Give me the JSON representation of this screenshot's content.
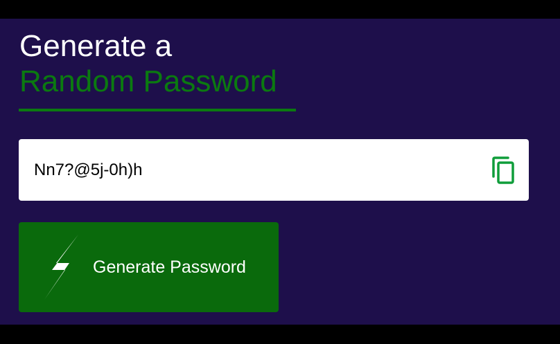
{
  "header": {
    "line1": "Generate a",
    "line2": "Random Password"
  },
  "password": {
    "value": "Nn7?@5j-0h)h",
    "copy_icon": "copy-icon"
  },
  "generate_button": {
    "label": "Generate Password",
    "icon": "lightning-bolt-icon"
  },
  "colors": {
    "background": "#1e0f4b",
    "accent_green": "#0b7a10",
    "button_green": "#0a6a0c",
    "copy_icon_green": "#0f9d3a"
  }
}
